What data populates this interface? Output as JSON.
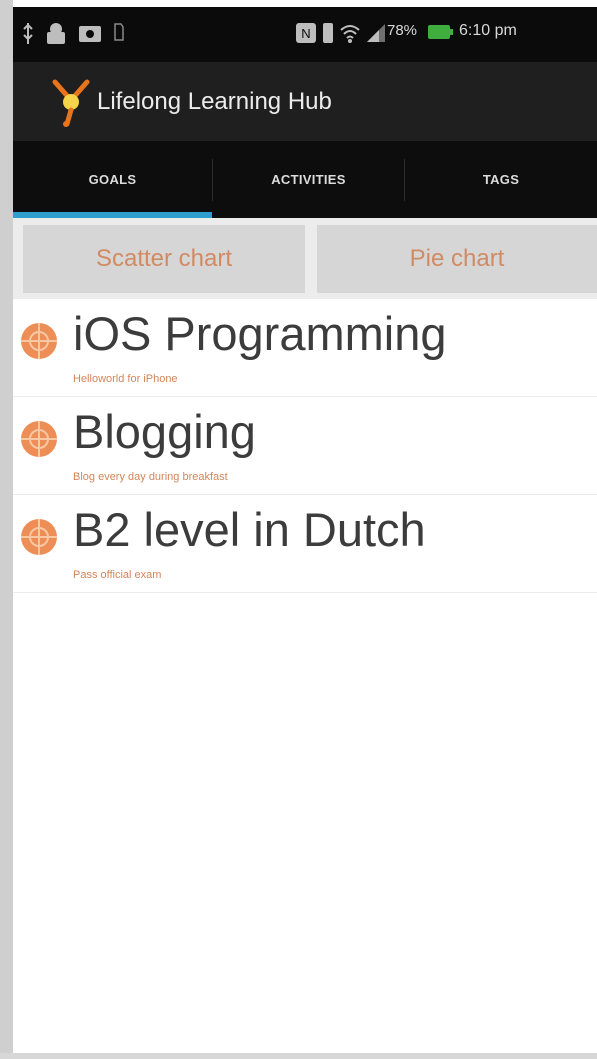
{
  "status_bar": {
    "battery_text": "78%",
    "time": "6:10 pm"
  },
  "app": {
    "title": "Lifelong Learning Hub",
    "accent_color": "#2e9ecd",
    "goal_text_color": "#d2855a"
  },
  "tabs": [
    {
      "label": "GOALS",
      "selected": true
    },
    {
      "label": "ACTIVITIES",
      "selected": false
    },
    {
      "label": "TAGS",
      "selected": false
    }
  ],
  "chart_buttons": {
    "scatter_label": "Scatter chart",
    "pie_label": "Pie chart"
  },
  "goals": [
    {
      "title": "iOS Programming",
      "subtitle": "Helloworld for iPhone",
      "icon": "goal-target-icon"
    },
    {
      "title": "Blogging",
      "subtitle": "Blog every day during breakfast",
      "icon": "goal-target-icon"
    },
    {
      "title": "B2 level in Dutch",
      "subtitle": "Pass official exam",
      "icon": "goal-target-icon"
    }
  ]
}
